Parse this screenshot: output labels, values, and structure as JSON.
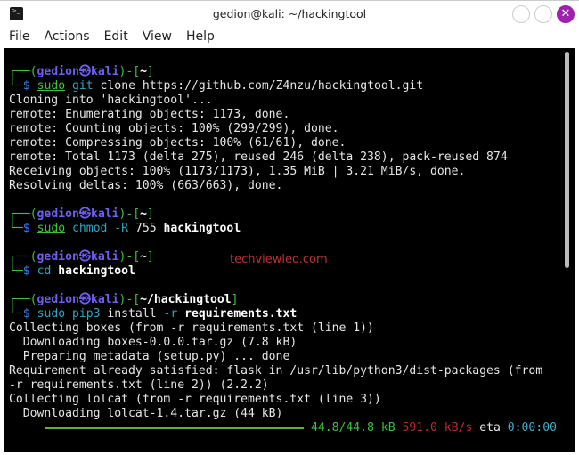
{
  "window": {
    "title": "gedion@kali: ~/hackingtool",
    "close_glyph": "✕"
  },
  "menu": [
    "File",
    "Actions",
    "Edit",
    "View",
    "Help"
  ],
  "watermark": "techviewleo.com",
  "lines": [
    [],
    [
      [
        "g",
        "┌──("
      ],
      [
        "p",
        "gedion㉿kali"
      ],
      [
        "g",
        ")-["
      ],
      [
        "w",
        "~"
      ],
      [
        "g",
        "]"
      ]
    ],
    [
      [
        "g",
        "└─"
      ],
      [
        "b",
        "$ "
      ],
      [
        "u",
        "sudo"
      ],
      [
        "",
        ""
      ],
      [
        "c",
        " git"
      ],
      [
        "",
        " clone https://github.com/Z4nzu/hackingtool.git"
      ]
    ],
    [
      [
        "",
        "Cloning into 'hackingtool'..."
      ]
    ],
    [
      [
        "",
        "remote: Enumerating objects: 1173, done."
      ]
    ],
    [
      [
        "",
        "remote: Counting objects: 100% (299/299), done."
      ]
    ],
    [
      [
        "",
        "remote: Compressing objects: 100% (61/61), done."
      ]
    ],
    [
      [
        "",
        "remote: Total 1173 (delta 275), reused 246 (delta 238), pack-reused 874"
      ]
    ],
    [
      [
        "",
        "Receiving objects: 100% (1173/1173), 1.35 MiB | 3.21 MiB/s, done."
      ]
    ],
    [
      [
        "",
        "Resolving deltas: 100% (663/663), done."
      ]
    ],
    [],
    [
      [
        "g",
        "┌──("
      ],
      [
        "p",
        "gedion㉿kali"
      ],
      [
        "g",
        ")-["
      ],
      [
        "w",
        "~"
      ],
      [
        "g",
        "]"
      ]
    ],
    [
      [
        "g",
        "└─"
      ],
      [
        "b",
        "$ "
      ],
      [
        "u",
        "sudo"
      ],
      [
        "c",
        " chmod -R"
      ],
      [
        "",
        " 755 "
      ],
      [
        "w",
        "hackingtool"
      ]
    ],
    [],
    [
      [
        "g",
        "┌──("
      ],
      [
        "p",
        "gedion㉿kali"
      ],
      [
        "g",
        ")-["
      ],
      [
        "w",
        "~"
      ],
      [
        "g",
        "]"
      ]
    ],
    [
      [
        "g",
        "└─"
      ],
      [
        "b",
        "$ "
      ],
      [
        "c",
        "cd"
      ],
      [
        "",
        " "
      ],
      [
        "w",
        "hackingtool"
      ]
    ],
    [],
    [
      [
        "g",
        "┌──("
      ],
      [
        "p",
        "gedion㉿kali"
      ],
      [
        "g",
        ")-["
      ],
      [
        "w",
        "~/hackingtool"
      ],
      [
        "g",
        "]"
      ]
    ],
    [
      [
        "g",
        "└─"
      ],
      [
        "b",
        "$ "
      ],
      [
        "c",
        "sudo pip3"
      ],
      [
        "",
        " install "
      ],
      [
        "c",
        "-r"
      ],
      [
        "",
        " "
      ],
      [
        "w",
        "requirements.txt"
      ]
    ],
    [
      [
        "",
        "Collecting boxes (from -r requirements.txt (line 1))"
      ]
    ],
    [
      [
        "",
        "  Downloading boxes-0.0.0.tar.gz (7.8 kB)"
      ]
    ],
    [
      [
        "",
        "  Preparing metadata (setup.py) ... done"
      ]
    ],
    [
      [
        "",
        "Requirement already satisfied: flask in /usr/lib/python3/dist-packages (from"
      ]
    ],
    [
      [
        "",
        "-r requirements.txt (line 2)) (2.2.2)"
      ]
    ],
    [
      [
        "",
        "Collecting lolcat (from -r requirements.txt (line 3))"
      ]
    ],
    [
      [
        "",
        "  Downloading lolcat-1.4.tar.gz (44 kB)"
      ]
    ]
  ],
  "progress": {
    "fraction": 1.0,
    "size": "44.8/44.8 kB",
    "speed": "591.0 kB/s",
    "eta_label": "eta",
    "eta": "0:00:00"
  }
}
